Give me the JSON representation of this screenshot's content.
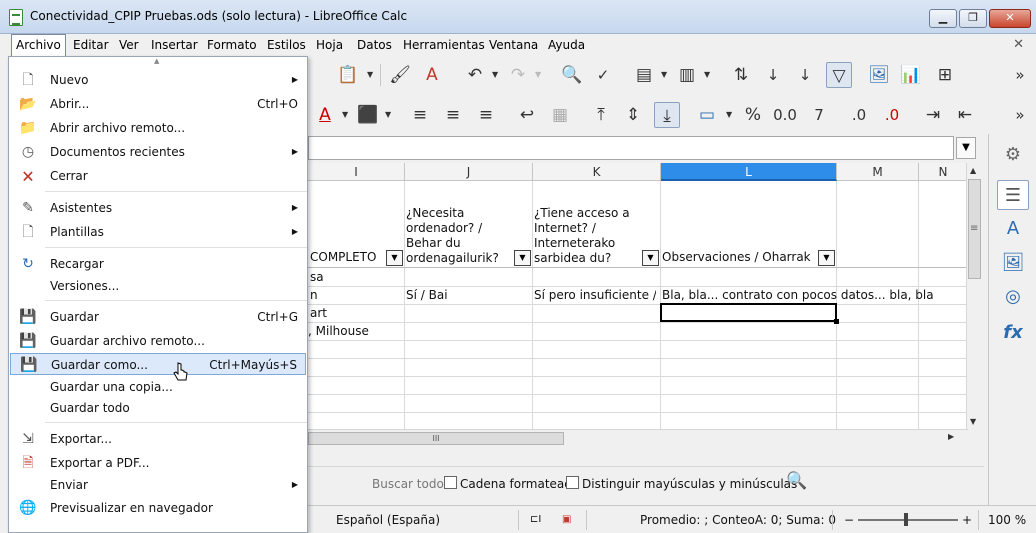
{
  "window": {
    "title": "Conectividad_CPIP Pruebas.ods (solo lectura) - LibreOffice Calc",
    "minimize": "▁",
    "maximize": "❐",
    "close": "✕"
  },
  "menubar": {
    "items": [
      "Archivo",
      "Editar",
      "Ver",
      "Insertar",
      "Formato",
      "Estilos",
      "Hoja",
      "Datos",
      "Herramientas",
      "Ventana",
      "Ayuda"
    ],
    "close": "✕"
  },
  "file_menu": {
    "items": [
      {
        "label": "Nuevo",
        "icon": "new-document-icon",
        "submenu": true
      },
      {
        "label": "Abrir...",
        "shortcut": "Ctrl+O",
        "icon": "open-folder-icon"
      },
      {
        "label": "Abrir archivo remoto...",
        "icon": "remote-folder-icon"
      },
      {
        "label": "Documentos recientes",
        "icon": "clock-icon",
        "submenu": true
      },
      {
        "label": "Cerrar",
        "icon": "close-document-icon"
      },
      {
        "label": "Asistentes",
        "icon": "wand-icon",
        "submenu": true
      },
      {
        "label": "Plantillas",
        "icon": "template-icon",
        "submenu": true
      },
      {
        "label": "Recargar",
        "icon": "reload-icon"
      },
      {
        "label": "Versiones...",
        "icon": ""
      },
      {
        "label": "Guardar",
        "shortcut": "Ctrl+G",
        "icon": "save-icon"
      },
      {
        "label": "Guardar archivo remoto...",
        "icon": "save-remote-icon"
      },
      {
        "label": "Guardar como...",
        "shortcut": "Ctrl+Mayús+S",
        "icon": "save-as-icon",
        "highlighted": true
      },
      {
        "label": "Guardar una copia...",
        "icon": ""
      },
      {
        "label": "Guardar todo",
        "icon": ""
      },
      {
        "label": "Exportar...",
        "icon": "export-icon"
      },
      {
        "label": "Exportar a PDF...",
        "icon": "pdf-icon"
      },
      {
        "label": "Enviar",
        "icon": "",
        "submenu": true
      },
      {
        "label": "Previsualizar en navegador",
        "icon": "globe-icon"
      }
    ]
  },
  "sheet": {
    "columns": [
      "I",
      "J",
      "K",
      "L",
      "M",
      "N"
    ],
    "selected_column": "L",
    "header_cells": {
      "I": "COMPLETO",
      "J": "¿Necesita ordenador? / Behar du ordenagailurik?",
      "K": "¿Tiene acceso a Internet? / Interneterako sarbidea du?",
      "L": "Observaciones / Oharrak"
    },
    "rows": [
      {
        "I": "sa",
        "J": "",
        "K": "",
        "L": ""
      },
      {
        "I": "n",
        "J": "Sí / Bai",
        "K": "Sí pero insuficiente / B",
        "L": "Bla, bla... contrato con pocos datos... bla, bla"
      },
      {
        "I": "art",
        "J": "",
        "K": "",
        "L": ""
      },
      {
        "I": ", Milhouse",
        "J": "",
        "K": "",
        "L": ""
      }
    ]
  },
  "findbar": {
    "search_all": "Buscar todo",
    "formatted": "Cadena formateada",
    "match_case": "Distinguir mayúsculas y minúsculas"
  },
  "statusbar": {
    "language": "Español (España)",
    "summary": "Promedio: ; ConteoA: 0; Suma: 0",
    "zoom_minus": "−",
    "zoom_plus": "+",
    "zoom": "100 %"
  },
  "scrollbar": {
    "hscroll_thumb": "III",
    "vscroll_marker": "≡"
  }
}
